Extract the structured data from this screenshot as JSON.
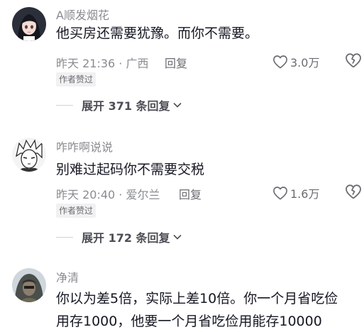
{
  "comments": [
    {
      "username": "A顺发烟花",
      "text_lines": [
        "他买房还需要犹豫。而你不需要。"
      ],
      "time": "昨天 21:36",
      "location": "广西",
      "reply_label": "回复",
      "likes": "3.0万",
      "badge": "作者赞过",
      "expand_label": "展开 371 条回复",
      "avatar_icon": "avatar-anime-girl-icon"
    },
    {
      "username": "咋咋啊说说",
      "text_lines": [
        "别难过起码你不需要交税"
      ],
      "time": "昨天 20:40",
      "location": "爱尔兰",
      "reply_label": "回复",
      "likes": "1.6万",
      "badge": "作者赞过",
      "expand_label": "展开 172 条回复",
      "avatar_icon": "avatar-manga-boy-icon"
    },
    {
      "username": "净清",
      "text_lines": [
        "你以为差5倍，实际上差10倍。你一个月省吃俭",
        "用存1000，他要一个月省吃俭用能存10000"
      ],
      "avatar_icon": "avatar-hooded-figure-icon"
    }
  ],
  "colors": {
    "text": "#161823",
    "meta": "#8a8b91",
    "badge_bg": "#f1f1f2"
  }
}
